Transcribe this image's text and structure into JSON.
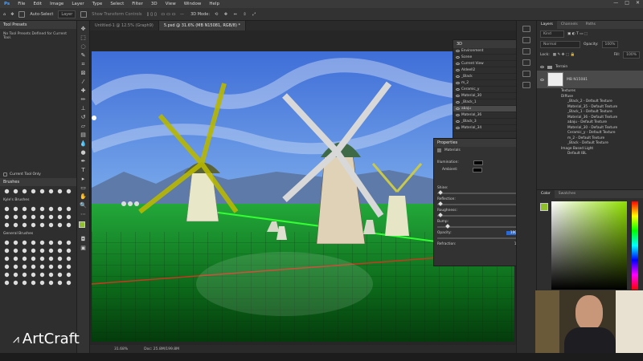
{
  "menu": [
    "File",
    "Edit",
    "Image",
    "Layer",
    "Type",
    "Select",
    "Filter",
    "3D",
    "View",
    "Window",
    "Help"
  ],
  "window_controls": [
    "—",
    "□",
    "✕"
  ],
  "options": {
    "auto_select": "Auto-Select",
    "layer_select": "Layer",
    "show_transform": "Show Transform Controls",
    "mode_3d": "3D Mode:"
  },
  "tool_presets": {
    "title": "Tool Presets",
    "empty_text": "No Tool Presets Defined for Current Tool.",
    "current_only": "Current Tool Only"
  },
  "brushes": {
    "title": "Brushes",
    "folder1": "Kyle's Brushes",
    "folder2": "General Brushes"
  },
  "tabs": [
    "Untitled-1 @ 12.5% (Graph9)",
    "5.psd @ 31.6% (MB N15081, RGB/8) *"
  ],
  "status": {
    "zoom": "31.68%",
    "doc": "Doc: 25.8M/199.8M"
  },
  "panel3d": {
    "title": "3D",
    "rows": [
      {
        "label": "Environment",
        "sel": false
      },
      {
        "label": "Scene",
        "sel": false
      },
      {
        "label": "Current View",
        "sel": false
      },
      {
        "label": "Aldeell2",
        "sel": false
      },
      {
        "label": "_Black",
        "sel": false
      },
      {
        "label": "m_2",
        "sel": false
      },
      {
        "label": "Ceramic_y",
        "sel": false
      },
      {
        "label": "Material_30",
        "sel": false
      },
      {
        "label": "_Black_1",
        "sel": false
      },
      {
        "label": "abaju",
        "sel": true
      },
      {
        "label": "Material_36",
        "sel": false
      },
      {
        "label": "_Black_3",
        "sel": false
      },
      {
        "label": "Material_34",
        "sel": false
      }
    ]
  },
  "properties": {
    "title": "Properties",
    "subtitle": "Materials",
    "illumination": "Illumination:",
    "ambient": "Ambient:",
    "sliders": [
      {
        "label": "Shine:",
        "value": "0%",
        "pos": 0.02,
        "hl": false
      },
      {
        "label": "Reflection:",
        "value": "0%",
        "pos": 0.02,
        "hl": false
      },
      {
        "label": "Roughness:",
        "value": "0%",
        "pos": 0.02,
        "hl": false
      },
      {
        "label": "Bump:",
        "value": "10%",
        "pos": 0.1,
        "hl": false
      },
      {
        "label": "Opacity:",
        "value": "100%",
        "pos": 0.98,
        "hl": true
      }
    ],
    "refraction": "Refraction:",
    "refraction_value": "1.000"
  },
  "layers": {
    "tabs": [
      "Layers",
      "Channels",
      "Paths"
    ],
    "kind": "Kind",
    "blend": "Normal",
    "opacity": "Opacity:",
    "opacity_val": "100%",
    "lock": "Lock:",
    "fill": "Fill:",
    "fill_val": "100%",
    "group": "Terrain",
    "layer": "MB N15081",
    "rows": [
      {
        "label": "Textures",
        "l2": false
      },
      {
        "label": "Diffuse",
        "l2": false
      },
      {
        "label": "_Black_2 - Default Texture",
        "l2": true
      },
      {
        "label": "Material_35 - Default Texture",
        "l2": true
      },
      {
        "label": "_Black_1 - Default Texture",
        "l2": true
      },
      {
        "label": "Material_36 - Default Texture",
        "l2": true
      },
      {
        "label": "abaju - Default Texture",
        "l2": true
      },
      {
        "label": "Material_30 - Default Texture",
        "l2": true
      },
      {
        "label": "Ceramic_y - Default Texture",
        "l2": true
      },
      {
        "label": "m_2 - Default Texture",
        "l2": true
      },
      {
        "label": "_Black - Default Texture",
        "l2": true
      },
      {
        "label": "Image Based Light",
        "l2": false
      },
      {
        "label": "Default IBL",
        "l2": true
      }
    ]
  },
  "color_panel": {
    "tabs": [
      "Color",
      "Swatches"
    ]
  },
  "logo": "ArtCraft",
  "colors": {
    "accent": "#2a6ad8",
    "fg_swatch": "#8fbf2a",
    "bg_swatch": "#ffffff"
  }
}
